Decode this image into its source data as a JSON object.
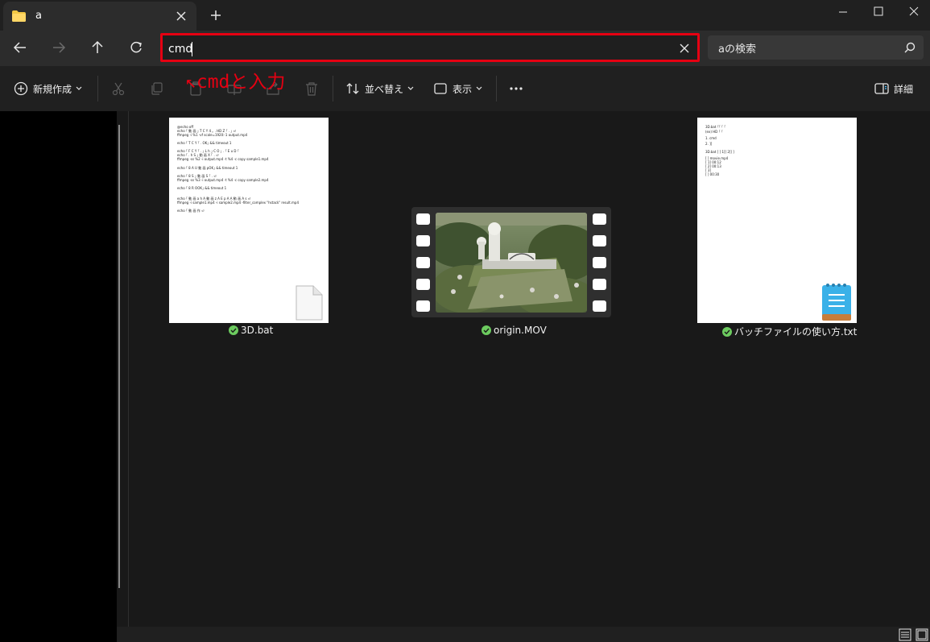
{
  "tab": {
    "title": "a"
  },
  "address": {
    "value": "cmd"
  },
  "search": {
    "placeholder": "aの検索"
  },
  "annotation": {
    "text": "↖cmdと入力"
  },
  "commandbar": {
    "new_label": "新規作成",
    "sort_label": "並べ替え",
    "view_label": "表示",
    "details_label": "詳細"
  },
  "files": [
    {
      "name": "3D.bat",
      "type": "bat",
      "preview_lines": [
        "@echo off",
        "echo ｢ 動 画 ｣ T C Y 4 ｡ . HD Z ｢ . ｣ ⏎",
        "ffmpeg -i %1 -vf scale=1920:-1 output.mp4",
        "echo ｢ T C Y ｢ . OK｣ && timeout 1",
        "echo ｢ F C Y ｢ . ｣ L h ｣ C O ｣ . ｢ E u D ｢",
        "echo ｢ . h S ｣ 動 画 X ｢ . ⏎",
        "ffmpeg -ss %2 -i output.mp4 -t %4 -c copy sample1.mp4",
        "echo ｢ 8 A U 動 画 pOK｣ && timeout 1",
        "echo ｢ 8 S ｣ 動 画 S ｢ . ⏎",
        "ffmpeg -ss %3 -i output.mp4 -t %4 -c copy sample2.mp4",
        "echo ｢ 8 R OOK｣ && timeout 1",
        "echo ｢ 動 画 a h A 動 画 z A E p A A 動 画 A s ⏎",
        "ffmpeg -i sample1.mp4 -i sample2.mp4 -filter_complex \"hstack\" result.mp4",
        "echo ｢ 動 画 作 ⏎"
      ]
    },
    {
      "name": "origin.MOV",
      "type": "video"
    },
    {
      "name": "バッチファイルの使い方.txt",
      "type": "txt",
      "preview_lines": [
        "3D.bat   ｢｢ ｢ ｢",
        "(ex)   HD   ｢   ｢",
        "1.   cmd",
        "2.   ][",
        "3D.bat [ ] 1[] 2[] ]",
        "[ ] movie.mp4",
        "[ 1] 00:12",
        "[ 2] 00:13",
        "[ 3]",
        "[ ] 00:30"
      ]
    }
  ],
  "colors": {
    "annotation": "#e60012",
    "highlight_border": "#e60012",
    "sync_ok": "#6ccb5f",
    "notepad": "#3ab1e8"
  }
}
